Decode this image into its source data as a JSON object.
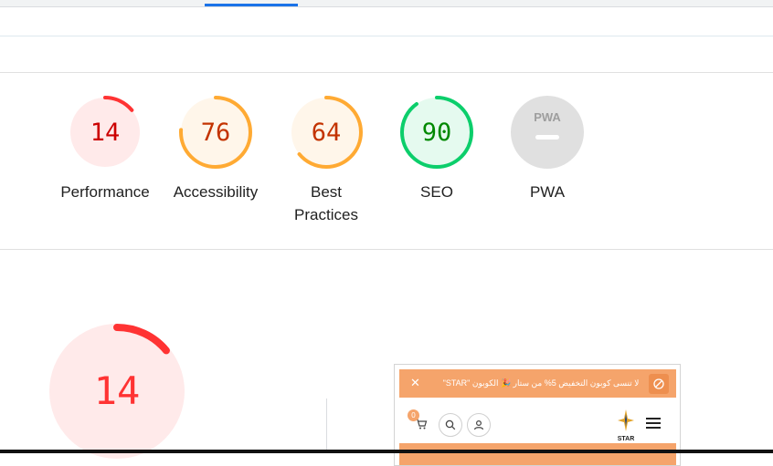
{
  "colors": {
    "fail": "#ff3333",
    "fail_bg": "#ffeaea",
    "fail_text": "#cc0000",
    "average": "#ffaa33",
    "average_bg": "#fff6ea",
    "average_text": "#c33300",
    "pass": "#0cce6b",
    "pass_bg": "#e5faef",
    "pass_text": "#008800",
    "na": "#e0e0e0",
    "na_text": "#9e9e9e",
    "promo": "#f5a46b",
    "tab_accent": "#1a73e8"
  },
  "scores": [
    {
      "value": "14",
      "label": "Performance",
      "level": "fail",
      "fraction": 0.14
    },
    {
      "value": "76",
      "label": "Accessibility",
      "level": "average",
      "fraction": 0.76
    },
    {
      "value": "64",
      "label": "Best Practices",
      "level": "average",
      "fraction": 0.64
    },
    {
      "value": "90",
      "label": "SEO",
      "level": "pass",
      "fraction": 0.9
    },
    {
      "value": "",
      "label": "PWA",
      "level": "na",
      "badge_text": "PWA"
    }
  ],
  "performance_detail": {
    "value": "14",
    "level": "fail",
    "fraction": 0.14
  },
  "preview": {
    "promo_text": "لا تنسى كوبون التخفيض 5% من ستار 🎉 الكوبون \"STAR\"",
    "close_symbol": "✕",
    "cart_count": "0",
    "logo_text": "STAR",
    "icons": [
      "cart-icon",
      "search-icon",
      "user-icon",
      "star-logo",
      "menu-icon",
      "no-entry-icon"
    ]
  }
}
